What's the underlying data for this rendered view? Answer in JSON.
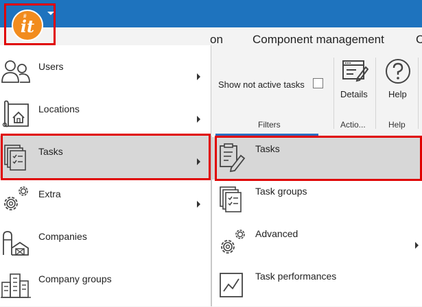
{
  "app": {
    "logo_text": "it",
    "logo_mark": "#",
    "colors": {
      "titlebar": "#1e73be",
      "logo": "#f28c1e",
      "highlight": "#e00000",
      "selected": "#d7d7d7"
    }
  },
  "ribbon": {
    "tabs": [
      {
        "label": "on"
      },
      {
        "label": "Component management"
      },
      {
        "label": "C"
      }
    ],
    "filters": {
      "show_not_active_label": "Show not active tasks",
      "group_label": "Filters"
    },
    "actions": {
      "details_label": "Details",
      "group_label": "Actio..."
    },
    "help": {
      "help_label": "Help",
      "group_label": "Help"
    }
  },
  "menu": {
    "items": [
      {
        "label": "Users",
        "icon": "users-icon",
        "has_submenu": true
      },
      {
        "label": "Locations",
        "icon": "location-map-icon",
        "has_submenu": true
      },
      {
        "label": "Tasks",
        "icon": "tasks-icon",
        "has_submenu": true,
        "selected": true
      },
      {
        "label": "Extra",
        "icon": "gears-icon",
        "has_submenu": true
      },
      {
        "label": "Companies",
        "icon": "companies-icon",
        "has_submenu": false
      },
      {
        "label": "Company groups",
        "icon": "company-groups-icon",
        "has_submenu": false
      }
    ]
  },
  "submenu": {
    "items": [
      {
        "label": "Tasks",
        "icon": "task-edit-icon",
        "selected": true
      },
      {
        "label": "Task groups",
        "icon": "task-groups-icon"
      },
      {
        "label": "Advanced",
        "icon": "gears-icon",
        "has_submenu": true
      },
      {
        "label": "Task performances",
        "icon": "chart-icon"
      }
    ]
  }
}
